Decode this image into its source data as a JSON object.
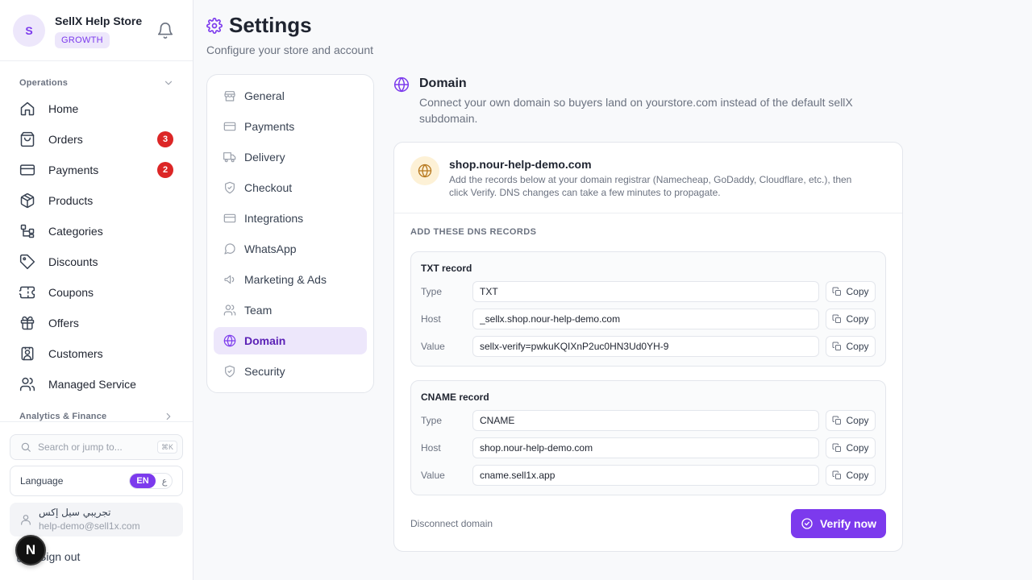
{
  "store": {
    "initial": "S",
    "name": "SellX Help Store",
    "plan": "GROWTH"
  },
  "sidebar": {
    "sections": [
      {
        "label": "Operations",
        "expanded": true
      },
      {
        "label": "Analytics & Finance",
        "expanded": false
      }
    ],
    "items": [
      {
        "label": "Home",
        "icon": "home-icon"
      },
      {
        "label": "Orders",
        "icon": "shopping-bag-icon",
        "badge": "3"
      },
      {
        "label": "Payments",
        "icon": "credit-card-icon",
        "badge": "2"
      },
      {
        "label": "Products",
        "icon": "package-icon"
      },
      {
        "label": "Categories",
        "icon": "tree-icon"
      },
      {
        "label": "Discounts",
        "icon": "tag-icon"
      },
      {
        "label": "Coupons",
        "icon": "ticket-icon"
      },
      {
        "label": "Offers",
        "icon": "gift-icon"
      },
      {
        "label": "Customers",
        "icon": "contact-icon"
      },
      {
        "label": "Managed Service",
        "icon": "users-icon"
      }
    ],
    "search": {
      "placeholder": "Search or jump to...",
      "shortcut": "⌘K"
    },
    "language": {
      "label": "Language",
      "active": "EN",
      "other": "ع"
    },
    "user": {
      "name": "تجريبي سيل إكس",
      "email": "help-demo@sell1x.com"
    },
    "signout": "Sign out",
    "fab": "N"
  },
  "header": {
    "title": "Settings",
    "subtitle": "Configure your store and account"
  },
  "settings_menu": [
    {
      "label": "General",
      "icon": "store-icon"
    },
    {
      "label": "Payments",
      "icon": "credit-card-icon"
    },
    {
      "label": "Delivery",
      "icon": "truck-icon"
    },
    {
      "label": "Checkout",
      "icon": "shield-check-icon"
    },
    {
      "label": "Integrations",
      "icon": "credit-card-icon"
    },
    {
      "label": "WhatsApp",
      "icon": "chat-icon"
    },
    {
      "label": "Marketing & Ads",
      "icon": "megaphone-icon"
    },
    {
      "label": "Team",
      "icon": "users-icon"
    },
    {
      "label": "Domain",
      "icon": "globe-icon",
      "active": true
    },
    {
      "label": "Security",
      "icon": "shield-icon"
    }
  ],
  "domain": {
    "title": "Domain",
    "description": "Connect your own domain so buyers land on yourstore.com instead of the default sellX subdomain.",
    "name": "shop.nour-help-demo.com",
    "help": "Add the records below at your domain registrar (Namecheap, GoDaddy, Cloudflare, etc.), then click Verify. DNS changes can take a few minutes to propagate.",
    "dns_heading": "ADD THESE DNS RECORDS",
    "records": [
      {
        "title": "TXT record",
        "rows": [
          {
            "label": "Type",
            "value": "TXT"
          },
          {
            "label": "Host",
            "value": "_sellx.shop.nour-help-demo.com"
          },
          {
            "label": "Value",
            "value": "sellx-verify=pwkuKQIXnP2uc0HN3Ud0YH-9"
          }
        ]
      },
      {
        "title": "CNAME record",
        "rows": [
          {
            "label": "Type",
            "value": "CNAME"
          },
          {
            "label": "Host",
            "value": "shop.nour-help-demo.com"
          },
          {
            "label": "Value",
            "value": "cname.sell1x.app"
          }
        ]
      }
    ],
    "copy_label": "Copy",
    "disconnect": "Disconnect domain",
    "verify": "Verify now"
  },
  "colors": {
    "accent": "#7c3aed",
    "accent_soft": "#ede7fb",
    "badge": "#dc2626",
    "domain_globe_bg": "#fdf1d6"
  }
}
